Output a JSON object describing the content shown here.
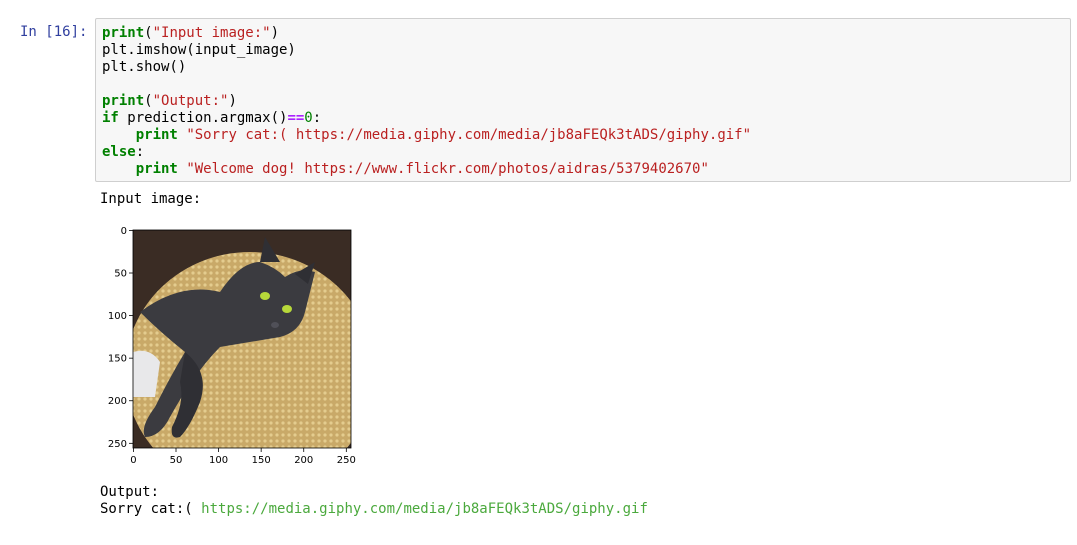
{
  "cell": {
    "prompt": "In [16]:",
    "code": {
      "line1_fn": "print",
      "line1_rest": "(",
      "line1_str": "\"Input image:\"",
      "line1_end": ")",
      "line2": "plt.imshow(input_image)",
      "line3": "plt.show()",
      "line5_fn": "print",
      "line5_rest": "(",
      "line5_str": "\"Output:\"",
      "line5_end": ")",
      "line6_kw": "if",
      "line6_a": " prediction.argmax()",
      "line6_op": "==",
      "line6_num": "0",
      "line6_end": ":",
      "line7_kw": "print",
      "line7_str": "\"Sorry cat:( https://media.giphy.com/media/jb8aFEQk3tADS/giphy.gif\"",
      "line8_kw": "else",
      "line8_end": ":",
      "line9_kw": "print",
      "line9_str": "\"Welcome dog! https://www.flickr.com/photos/aidras/5379402670\""
    }
  },
  "output": {
    "input_label": "Input image:",
    "output_label": "Output:",
    "result_prefix": "Sorry cat:( ",
    "result_link": "https://media.giphy.com/media/jb8aFEQk3tADS/giphy.gif"
  },
  "image_plot": {
    "y_ticks": [
      "0",
      "50",
      "100",
      "150",
      "200",
      "250"
    ],
    "x_ticks": [
      "0",
      "50",
      "100",
      "150",
      "200",
      "250"
    ],
    "image_subject": "cat-photo"
  }
}
